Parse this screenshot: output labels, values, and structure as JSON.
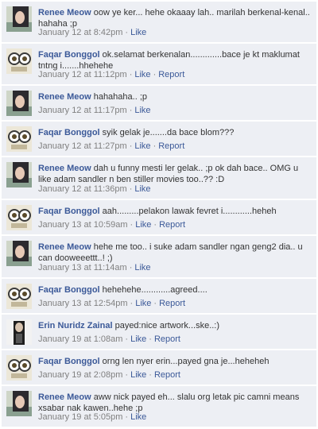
{
  "separator": "·",
  "comments": [
    {
      "author": "Renee Meow",
      "avatar": "renee-photo-icon",
      "text": "oow ye ker... hehe okaaay lah.. marilah berkenal-kenal.. hahaha ;p",
      "time": "January 12 at 8:42pm",
      "like": "Like"
    },
    {
      "author": "Faqar Bonggol",
      "avatar": "faqar-eyes-icon",
      "text": "ok.selamat berkenalan.............bace je kt maklumat tntng i.......hhehehe",
      "time": "January 12 at 11:12pm",
      "like": "Like",
      "report": "Report"
    },
    {
      "author": "Renee Meow",
      "avatar": "renee-photo-icon",
      "text": "hahahaha.. ;p",
      "time": "January 12 at 11:17pm",
      "like": "Like"
    },
    {
      "author": "Faqar Bonggol",
      "avatar": "faqar-eyes-icon",
      "text": "syik gelak je.......da bace blom???",
      "time": "January 12 at 11:27pm",
      "like": "Like",
      "report": "Report"
    },
    {
      "author": "Renee Meow",
      "avatar": "renee-photo-icon",
      "text": "dah u funny mesti ler gelak.. ;p ok dah bace.. OMG u like adam sandler n ben stiller movies too..?? :D",
      "time": "January 12 at 11:36pm",
      "like": "Like"
    },
    {
      "author": "Faqar Bonggol",
      "avatar": "faqar-eyes-icon",
      "text": "aah.........pelakon lawak fevret i............heheh",
      "time": "January 13 at 10:59am",
      "like": "Like",
      "report": "Report"
    },
    {
      "author": "Renee Meow",
      "avatar": "renee-photo-icon",
      "text": "hehe me too.. i suke adam sandler ngan geng2 dia.. u can dooweeettt..! ;)",
      "time": "January 13 at 11:14am",
      "like": "Like"
    },
    {
      "author": "Faqar Bonggol",
      "avatar": "faqar-eyes-icon",
      "text": "hehehehe............agreed....",
      "time": "January 13 at 12:54pm",
      "like": "Like",
      "report": "Report"
    },
    {
      "author": "Erin Nuridz Zainal",
      "avatar": "erin-photo-icon",
      "text": "payed:nice artwork...ske..:)",
      "time": "January 19 at 1:08am",
      "like": "Like",
      "report": "Report"
    },
    {
      "author": "Faqar Bonggol",
      "avatar": "faqar-eyes-icon",
      "text": "orng len nyer erin...payed gna je...heheheh",
      "time": "January 19 at 2:08pm",
      "like": "Like",
      "report": "Report"
    },
    {
      "author": "Renee Meow",
      "avatar": "renee-photo-icon",
      "text": "aww nick payed eh... slalu org letak pic camni means xsabar nak kawen..hehe ;p",
      "time": "January 19 at 5:05pm",
      "like": "Like"
    }
  ]
}
